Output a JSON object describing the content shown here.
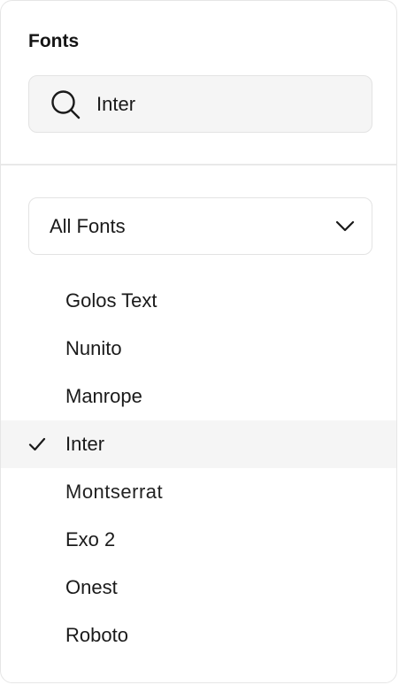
{
  "panel": {
    "title": "Fonts"
  },
  "search": {
    "value": "Inter",
    "icon": "search-icon"
  },
  "filter": {
    "selected": "All Fonts",
    "icon": "chevron-down-icon"
  },
  "fonts": {
    "items": [
      {
        "label": "Golos Text",
        "selected": false
      },
      {
        "label": "Nunito",
        "selected": false
      },
      {
        "label": "Manrope",
        "selected": false
      },
      {
        "label": "Inter",
        "selected": true
      },
      {
        "label": "Montserrat",
        "selected": false
      },
      {
        "label": "Exo 2",
        "selected": false
      },
      {
        "label": "Onest",
        "selected": false
      },
      {
        "label": "Roboto",
        "selected": false
      }
    ],
    "check_icon": "check-icon"
  },
  "colors": {
    "text": "#1a1a1a",
    "field_bg": "#f5f5f5",
    "border": "#e3e3e3",
    "selected_row_bg": "#f5f5f5"
  }
}
